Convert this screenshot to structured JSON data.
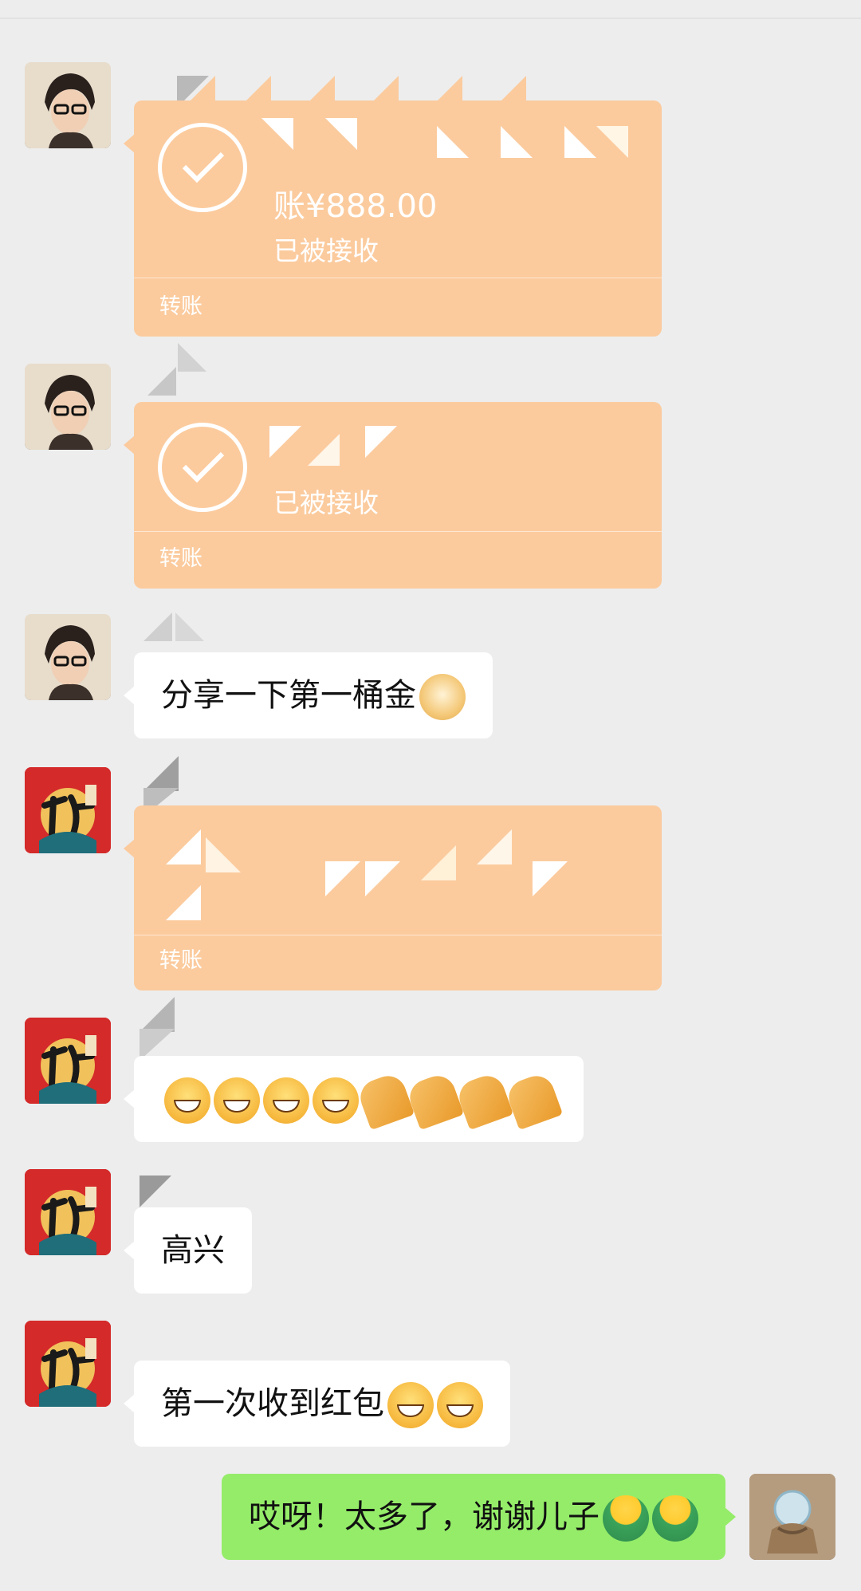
{
  "messages": [
    {
      "id": "m1",
      "type": "transfer",
      "side": "left",
      "avatar": "person-glasses-avatar",
      "amount": "账¥888.00",
      "status": "已被接收",
      "kind": "转账"
    },
    {
      "id": "m2",
      "type": "transfer",
      "side": "left",
      "avatar": "person-glasses-avatar",
      "amount": "",
      "status": "已被接收",
      "kind": "转账"
    },
    {
      "id": "m3",
      "type": "text",
      "side": "left",
      "avatar": "person-glasses-avatar",
      "text": "分享一下第一桶金",
      "emoji": [
        "doge-emoji"
      ]
    },
    {
      "id": "m4",
      "type": "transfer",
      "side": "left",
      "avatar": "fu-avatar",
      "amount": "",
      "status": "",
      "kind": "转账"
    },
    {
      "id": "m5",
      "type": "text",
      "side": "left",
      "avatar": "fu-avatar",
      "text": "",
      "emoji": [
        "grin-emoji",
        "grin-emoji",
        "grin-emoji",
        "grin-emoji",
        "folded-hands-emoji",
        "folded-hands-emoji",
        "folded-hands-emoji",
        "folded-hands-emoji"
      ]
    },
    {
      "id": "m6",
      "type": "text",
      "side": "left",
      "avatar": "fu-avatar",
      "text": "高兴"
    },
    {
      "id": "m7",
      "type": "text",
      "side": "left",
      "avatar": "fu-avatar",
      "text": "第一次收到红包",
      "emoji": [
        "grin-emoji",
        "grin-emoji"
      ]
    },
    {
      "id": "m8",
      "type": "text",
      "side": "right",
      "avatar": "crystal-ball-avatar",
      "text": "哎呀！太多了，谢谢儿子",
      "emoji": [
        "green-person-emoji",
        "green-person-emoji"
      ]
    }
  ],
  "colors": {
    "background": "#ededed",
    "transfer": "#fbcb9e",
    "received_bubble": "#ffffff",
    "sent_bubble": "#95ec69"
  }
}
